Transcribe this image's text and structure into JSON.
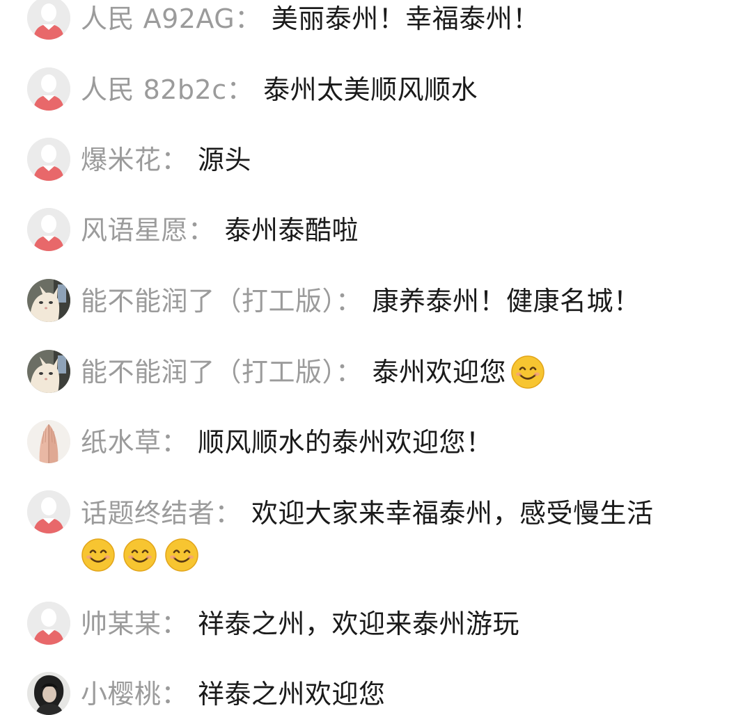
{
  "comments": [
    {
      "user": "人民 A92AG",
      "sep": "：",
      "text": "美丽泰州！幸福泰州！",
      "avatar": "default-avatar"
    },
    {
      "user": "人民 82b2c",
      "sep": "：",
      "text": "泰州太美顺风顺水",
      "avatar": "default-avatar"
    },
    {
      "user": "爆米花",
      "sep": "：",
      "text": "源头",
      "avatar": "default-avatar"
    },
    {
      "user": "风语星愿",
      "sep": "：",
      "text": "泰州泰酷啦",
      "avatar": "default-avatar"
    },
    {
      "user": "能不能润了（打工版）",
      "sep": "：",
      "text": "康养泰州！健康名城！",
      "avatar": "cat-photo-avatar"
    },
    {
      "user": "能不能润了（打工版）",
      "sep": "：",
      "text": "泰州欢迎您",
      "avatar": "cat-photo-avatar",
      "emoji": [
        "smiling-face-emoji"
      ]
    },
    {
      "user": "纸水草",
      "sep": "：",
      "text": "顺风顺水的泰州欢迎您！",
      "avatar": "praying-hands-avatar"
    },
    {
      "user": "话题终结者",
      "sep": "：",
      "text": "欢迎大家来幸福泰州，感受慢生活",
      "avatar": "default-avatar",
      "emoji_line": [
        "smiling-face-emoji",
        "smiling-face-emoji",
        "smiling-face-emoji"
      ]
    },
    {
      "user": "帅某某",
      "sep": "：",
      "text": "祥泰之州，欢迎来泰州游玩",
      "avatar": "default-avatar"
    },
    {
      "user": "小樱桃",
      "sep": "：",
      "text": "祥泰之州欢迎您",
      "avatar": "portrait-photo-avatar"
    }
  ],
  "colors": {
    "username": "#9b9b9b",
    "message": "#1a1a1a",
    "avatar_background": "#ebebeb",
    "avatar_shirt": "#e8686a",
    "avatar_head": "#ffffff",
    "emoji_face": "#f7c531"
  }
}
